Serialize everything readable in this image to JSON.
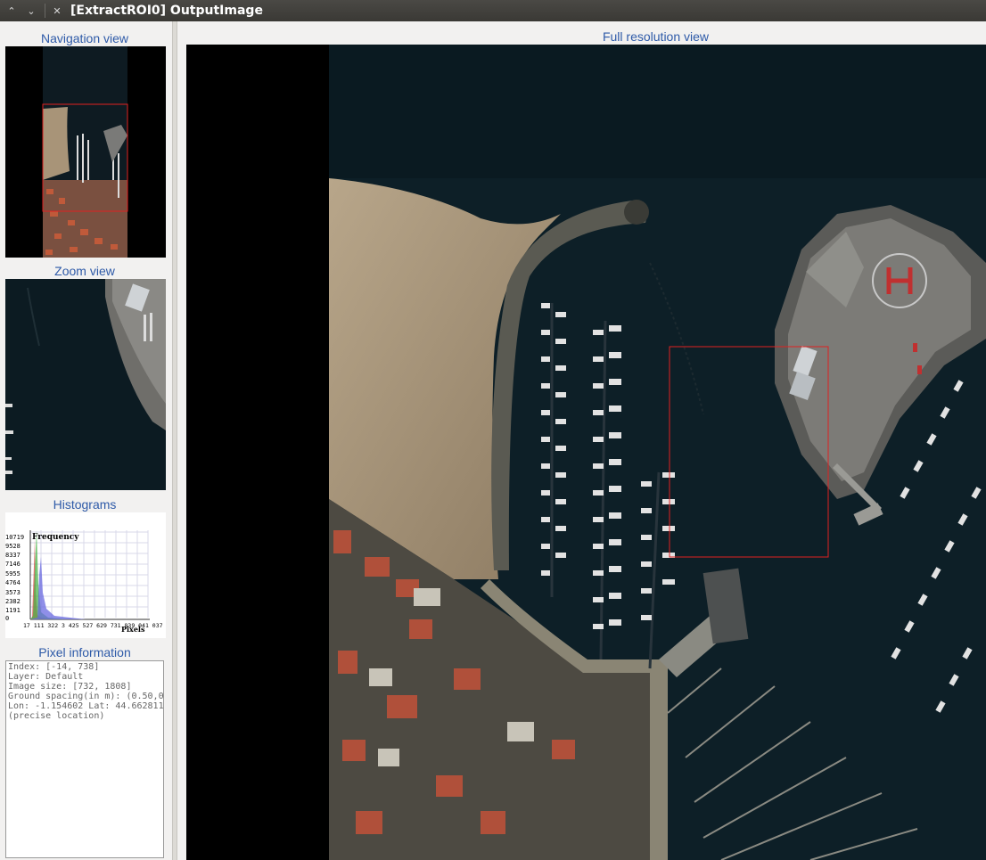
{
  "window": {
    "title": "[ExtractROI0] OutputImage",
    "buttons": [
      "^",
      "v",
      "x"
    ]
  },
  "left_panel": {
    "navigation_title": "Navigation view",
    "zoom_title": "Zoom view",
    "histograms_title": "Histograms",
    "pixel_info_title": "Pixel information"
  },
  "histogram": {
    "y_label": "Frequency",
    "x_label": "Pixels",
    "y_ticks": [
      "10719",
      "9528",
      "8337",
      "7146",
      "5955",
      "4764",
      "3573",
      "2382",
      "1191",
      "0"
    ],
    "x_ticks": "17 111 322 3 425 527 629 731 839 041 037",
    "series_colors": {
      "red": "#d94040",
      "green": "#40b040",
      "blue": "#6a6ae0"
    }
  },
  "pixel_info": {
    "lines": [
      "Index: [-14, 738]",
      "Layer: Default",
      "Image size: [732, 1808]",
      "Ground spacing(in m): (0.50,0",
      "Lon: -1.154602 Lat: 44.662811",
      "(precise location)"
    ]
  },
  "main": {
    "title": "Full resolution view"
  },
  "colors": {
    "title_blue": "#2e5aa8",
    "roi_red": "#e02020",
    "water": "#0f2028",
    "sand": "#9c8a70"
  }
}
